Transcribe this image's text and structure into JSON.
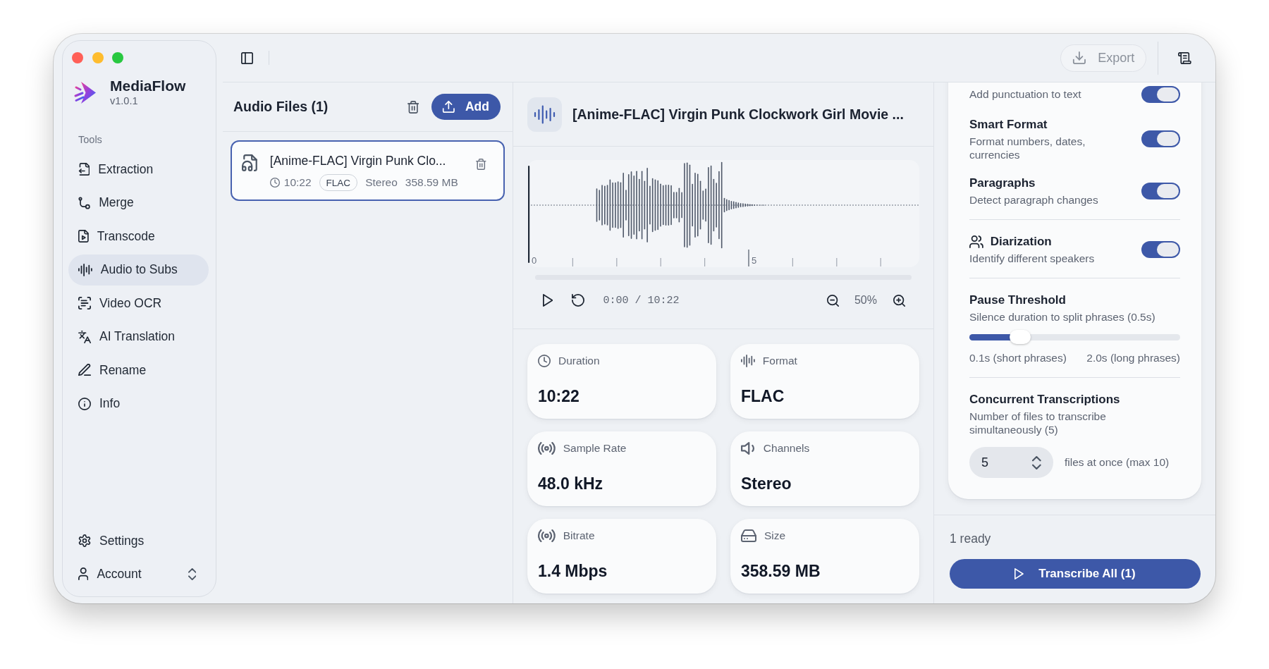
{
  "sidebar": {
    "app_name": "MediaFlow",
    "version": "v1.0.1",
    "section_label": "Tools",
    "items": [
      {
        "kind": "extraction",
        "label": "Extraction",
        "selected": false
      },
      {
        "kind": "merge",
        "label": "Merge",
        "selected": false
      },
      {
        "kind": "transcode",
        "label": "Transcode",
        "selected": false
      },
      {
        "kind": "audio_to_subs",
        "label": "Audio to Subs",
        "selected": true
      },
      {
        "kind": "video_ocr",
        "label": "Video OCR",
        "selected": false
      },
      {
        "kind": "translation",
        "label": "AI Translation",
        "selected": false
      },
      {
        "kind": "rename",
        "label": "Rename",
        "selected": false
      },
      {
        "kind": "info",
        "label": "Info",
        "selected": false
      }
    ],
    "footer_items": [
      {
        "kind": "settings",
        "label": "Settings"
      },
      {
        "kind": "account",
        "label": "Account"
      }
    ]
  },
  "toolbar": {
    "export": {
      "label": "Export",
      "disabled": true
    }
  },
  "files_panel": {
    "title": "Audio Files (1)",
    "add_button": "Add",
    "files": [
      {
        "name": "[Anime-FLAC] Virgin Punk Clo...",
        "duration": "10:22",
        "format": "FLAC",
        "channels": "Stereo",
        "size": "358.59 MB",
        "selected": true
      }
    ]
  },
  "preview": {
    "title": "[Anime-FLAC] Virgin Punk Clockwork Girl Movie ...",
    "tick_labels": [
      "0",
      "5"
    ],
    "time": "0:00 / 10:22",
    "zoom": "50%",
    "stats": [
      {
        "kind": "duration",
        "label": "Duration",
        "value": "10:22"
      },
      {
        "kind": "format",
        "label": "Format",
        "value": "FLAC"
      },
      {
        "kind": "sample_rate",
        "label": "Sample Rate",
        "value": "48.0 kHz"
      },
      {
        "kind": "channels",
        "label": "Channels",
        "value": "Stereo"
      },
      {
        "kind": "bitrate",
        "label": "Bitrate",
        "value": "1.4 Mbps"
      },
      {
        "kind": "size",
        "label": "Size",
        "value": "358.59 MB"
      }
    ]
  },
  "settings": {
    "sections": [
      {
        "rows": [
          {
            "kind": "toggle",
            "description": "Add punctuation to text",
            "on": true
          },
          {
            "kind": "toggle",
            "title": "Smart Format",
            "description": "Format numbers, dates, currencies",
            "on": true
          },
          {
            "kind": "toggle",
            "title": "Paragraphs",
            "description": "Detect paragraph changes",
            "on": true
          }
        ]
      },
      {
        "rows": [
          {
            "kind": "speaker_toggle",
            "title": "Diarization",
            "description": "Identify different speakers",
            "on": true
          }
        ]
      },
      {
        "rows": [
          {
            "kind": "slider",
            "title": "Pause Threshold",
            "description": "Silence duration to split phrases (0.5s)",
            "level": 0.24,
            "min_label": "0.1s (short phrases)",
            "max_label": "2.0s (long phrases)"
          }
        ]
      },
      {
        "rows": [
          {
            "kind": "number",
            "title": "Concurrent Transcriptions",
            "description": "Number of files to transcribe simultaneously (5)",
            "value": "5",
            "suffix": "files at once (max 10)"
          }
        ]
      }
    ]
  },
  "footer": {
    "status": "1 ready",
    "button": "Transcribe All (1)"
  }
}
